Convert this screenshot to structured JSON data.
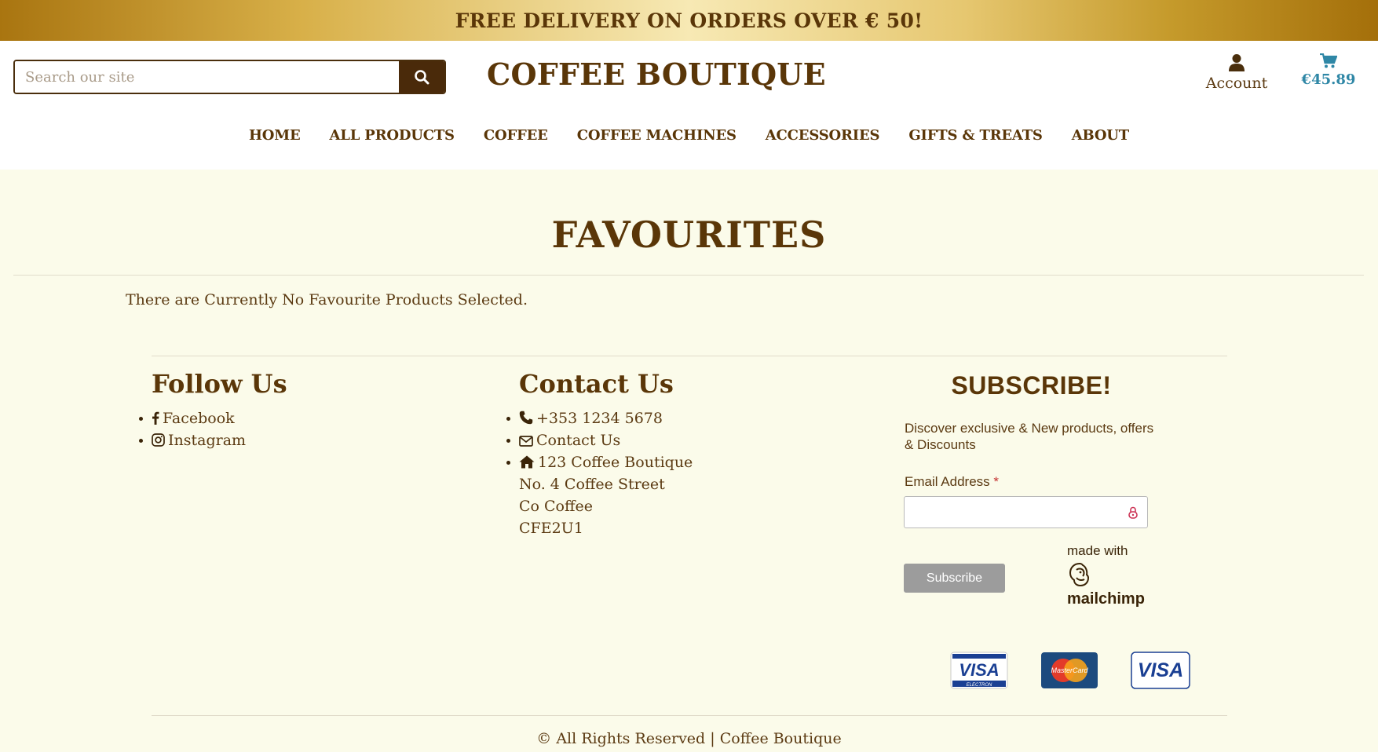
{
  "topbar": {
    "text": "FREE DELIVERY ON ORDERS OVER € 50!"
  },
  "search": {
    "placeholder": "Search our site"
  },
  "brand": {
    "name": "COFFEE BOUTIQUE"
  },
  "account": {
    "label": "Account"
  },
  "cart": {
    "total": "€45.89"
  },
  "nav": {
    "items": [
      "HOME",
      "ALL PRODUCTS",
      "COFFEE",
      "COFFEE MACHINES",
      "ACCESSORIES",
      "GIFTS & TREATS",
      "ABOUT"
    ]
  },
  "page": {
    "title": "FAVOURITES",
    "empty_message": "There are Currently No Favourite Products Selected."
  },
  "follow": {
    "title": "Follow Us",
    "facebook": "Facebook",
    "instagram": "Instagram"
  },
  "contact": {
    "title": "Contact Us",
    "phone": "+353 1234 5678",
    "email_link": "Contact Us",
    "address": [
      "123 Coffee Boutique",
      "No. 4 Coffee Street",
      "Co Coffee",
      "CFE2U1"
    ]
  },
  "subscribe": {
    "title": "SUBSCRIBE!",
    "description": "Discover exclusive & New products, offers & Discounts",
    "email_label": "Email Address",
    "required_mark": "*",
    "button": "Subscribe",
    "made_with": "made with",
    "mailchimp": "mailchimp"
  },
  "payment": {
    "cards": [
      "VISA",
      "MasterCard",
      "VISA"
    ],
    "electron": "ELECTRON"
  },
  "footer": {
    "copyright_icon": "©",
    "text": "All Rights Reserved",
    "separator": "|",
    "company": "Coffee Boutique"
  },
  "colors": {
    "accent_brown": "#5a3608",
    "gold": "#d8b049",
    "cart_blue": "#2f87a6",
    "bg_cream": "#fbfbea"
  }
}
